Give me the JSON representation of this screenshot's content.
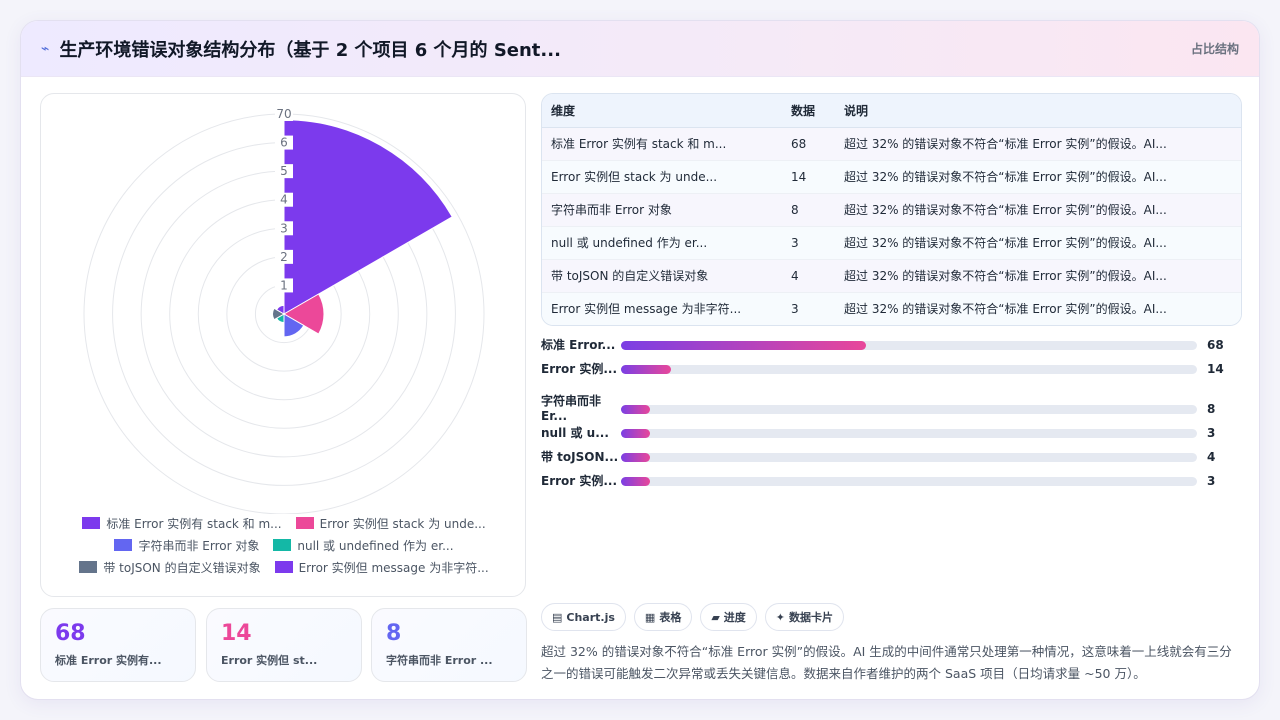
{
  "header": {
    "logo": "⌁",
    "title": "生产环境错误对象结构分布（基于 2 个项目 6 个月的 Sent...",
    "tag": "占比结构"
  },
  "chart_data": {
    "type": "polarArea",
    "categories": [
      "标准 Error 实例有 stack 和 m...",
      "Error 实例但 stack 为 unde...",
      "字符串而非 Error 对象",
      "null 或 undefined 作为 er...",
      "带 toJSON 的自定义错误对象",
      "Error 实例但 message 为非字符..."
    ],
    "values": [
      68,
      14,
      8,
      3,
      4,
      3
    ],
    "colors": [
      "#7c3aed",
      "#ec4899",
      "#6366f1",
      "#14b8a6",
      "#64748b",
      "#7c3aed"
    ],
    "radial_ticks": [
      "1",
      "2",
      "3",
      "4",
      "5",
      "6",
      "70"
    ],
    "rmax": 70,
    "legend_position": "bottom"
  },
  "stats": [
    {
      "value": "68",
      "label": "标准 Error 实例有...",
      "color": "#7c3aed"
    },
    {
      "value": "14",
      "label": "Error 实例但 st...",
      "color": "#ec4899"
    },
    {
      "value": "8",
      "label": "字符串而非 Error ...",
      "color": "#6366f1"
    }
  ],
  "table": {
    "headers": [
      "维度",
      "数据",
      "说明"
    ],
    "rows": [
      [
        "标准 Error 实例有 stack 和 m...",
        "68",
        "超过 32% 的错误对象不符合“标准 Error 实例”的假设。AI..."
      ],
      [
        "Error 实例但 stack 为 unde...",
        "14",
        "超过 32% 的错误对象不符合“标准 Error 实例”的假设。AI..."
      ],
      [
        "字符串而非 Error 对象",
        "8",
        "超过 32% 的错误对象不符合“标准 Error 实例”的假设。AI..."
      ],
      [
        "null 或 undefined 作为 er...",
        "3",
        "超过 32% 的错误对象不符合“标准 Error 实例”的假设。AI..."
      ],
      [
        "带 toJSON 的自定义错误对象",
        "4",
        "超过 32% 的错误对象不符合“标准 Error 实例”的假设。AI..."
      ],
      [
        "Error 实例但 message 为非字符...",
        "3",
        "超过 32% 的错误对象不符合“标准 Error 实例”的假设。AI..."
      ]
    ]
  },
  "bars": {
    "max": 160,
    "items": [
      {
        "label": "标准 Error...",
        "value": 68
      },
      {
        "label": "Error 实例...",
        "value": 14
      },
      {
        "label": "字符串而非 Er...",
        "value": 8
      },
      {
        "label": "null 或 u...",
        "value": 3
      },
      {
        "label": "带 toJSON...",
        "value": 4
      },
      {
        "label": "Error 实例...",
        "value": 3
      }
    ]
  },
  "chips": [
    {
      "icon": "▤",
      "label": "Chart.js"
    },
    {
      "icon": "▦",
      "label": "表格"
    },
    {
      "icon": "▰",
      "label": "进度"
    },
    {
      "icon": "✦",
      "label": "数据卡片"
    }
  ],
  "note": "超过 32% 的错误对象不符合“标准 Error 实例”的假设。AI 生成的中间件通常只处理第一种情况，这意味着一上线就会有三分之一的错误可能触发二次异常或丢失关键信息。数据来自作者维护的两个 SaaS 项目（日均请求量 ~50 万）。"
}
